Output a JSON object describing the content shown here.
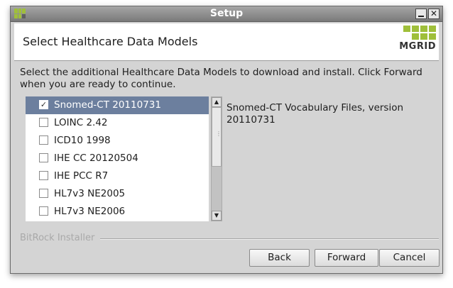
{
  "window": {
    "title": "Setup",
    "minimize_glyph": "",
    "close_glyph": "✕"
  },
  "header": {
    "title": "Select Healthcare Data Models",
    "logo_text": "MGRID"
  },
  "instructions": "Select the additional Healthcare Data Models to download and install. Click Forward when you are ready to continue.",
  "models": [
    {
      "label": "Snomed-CT 20110731",
      "checked": true,
      "selected": true
    },
    {
      "label": "LOINC 2.42",
      "checked": false,
      "selected": false
    },
    {
      "label": "ICD10 1998",
      "checked": false,
      "selected": false
    },
    {
      "label": "IHE CC 20120504",
      "checked": false,
      "selected": false
    },
    {
      "label": "IHE PCC R7",
      "checked": false,
      "selected": false
    },
    {
      "label": "HL7v3 NE2005",
      "checked": false,
      "selected": false
    },
    {
      "label": "HL7v3 NE2006",
      "checked": false,
      "selected": false
    }
  ],
  "description": "Snomed-CT Vocabulary Files, version 20110731",
  "footer": {
    "brand": "BitRock Installer"
  },
  "buttons": {
    "back": "Back",
    "forward": "Forward",
    "cancel": "Cancel"
  },
  "icons": {
    "check": "✓",
    "scroll_up": "▲",
    "scroll_down": "▼",
    "grip": "⋮"
  },
  "colors": {
    "selection": "#6c7f9e",
    "logo_green": "#9fbf3a",
    "titlebar": "#8e8e8e"
  }
}
